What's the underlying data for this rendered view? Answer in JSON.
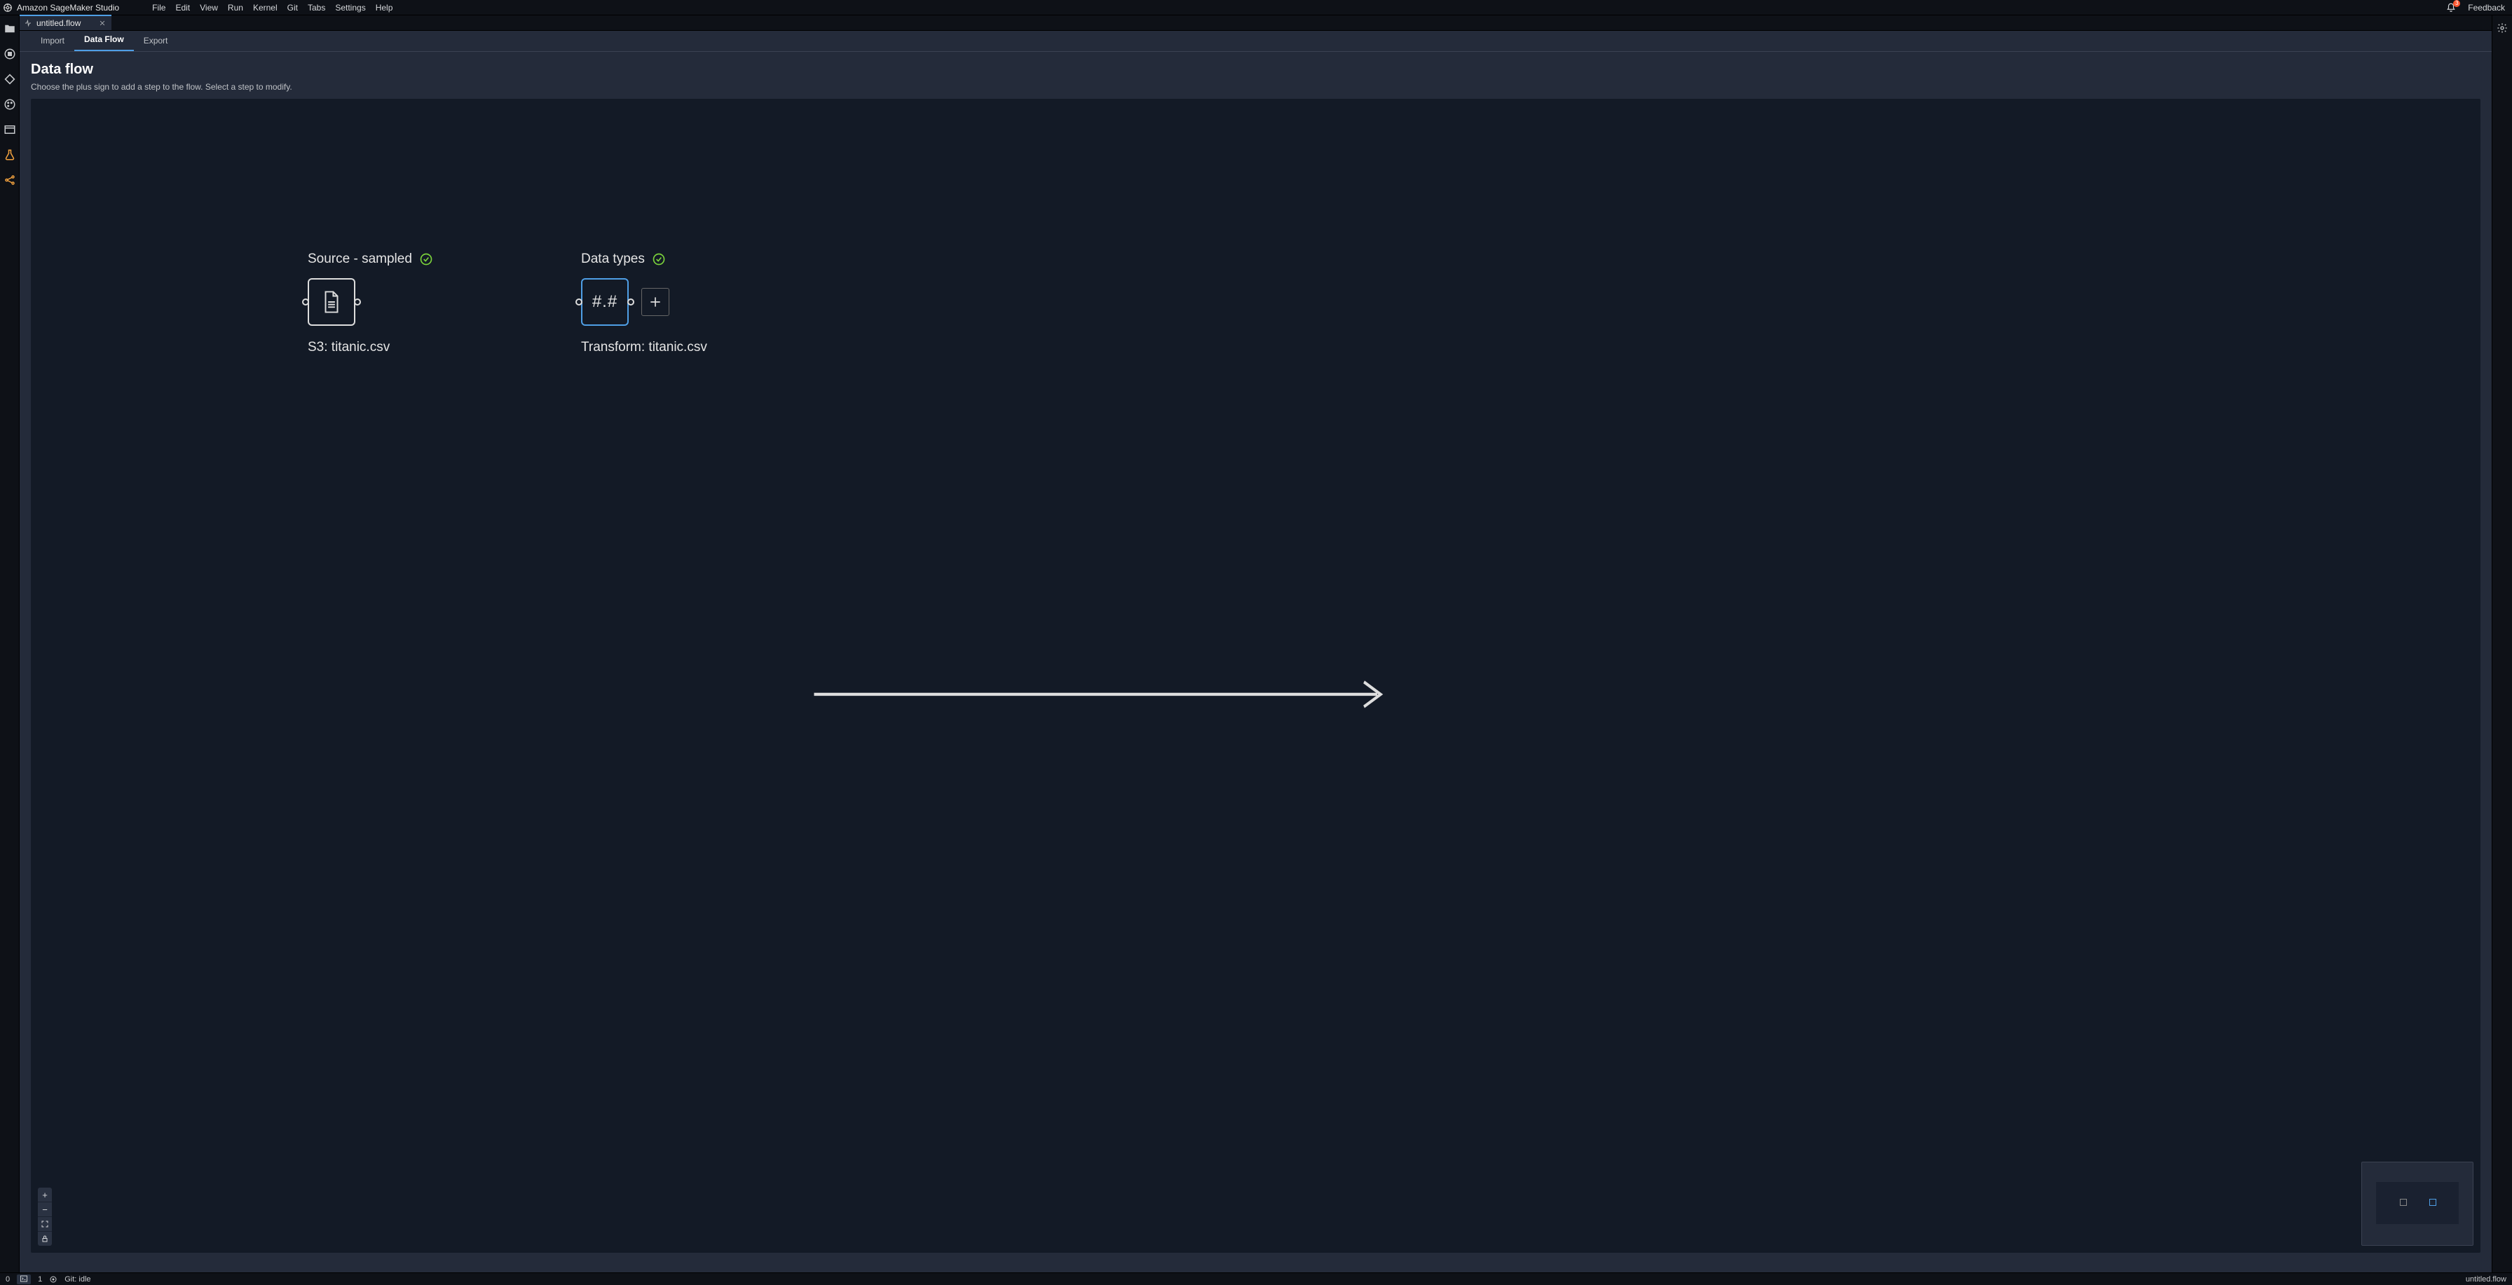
{
  "menubar": {
    "brand": "Amazon SageMaker Studio",
    "items": [
      "File",
      "Edit",
      "View",
      "Run",
      "Kernel",
      "Git",
      "Tabs",
      "Settings",
      "Help"
    ],
    "feedback": "Feedback",
    "notification_count": "3"
  },
  "tab": {
    "title": "untitled.flow"
  },
  "flow_tabs": {
    "import": "Import",
    "data_flow": "Data Flow",
    "export": "Export"
  },
  "header": {
    "title": "Data flow",
    "subtitle": "Choose the plus sign to add a step to the flow. Select a step to modify."
  },
  "nodes": {
    "source": {
      "title": "Source - sampled",
      "subtitle": "S3: titanic.csv"
    },
    "transform": {
      "title": "Data types",
      "subtitle": "Transform: titanic.csv",
      "glyph": "#.#"
    }
  },
  "status": {
    "left_count": "0",
    "terminals": "1",
    "git": "Git: idle",
    "right_file": "untitled.flow"
  }
}
